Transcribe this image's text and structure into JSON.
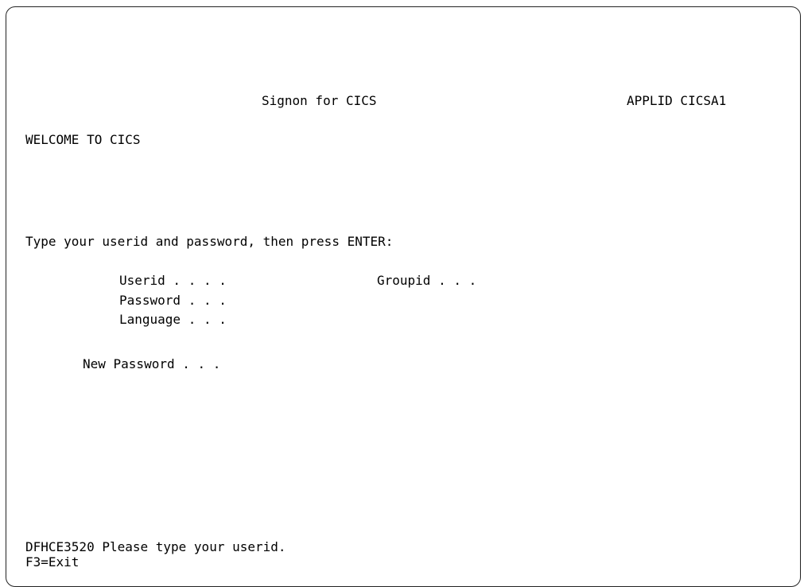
{
  "screen": {
    "title": "Signon for CICS",
    "applid": "APPLID CICSA1",
    "welcome": "WELCOME TO CICS",
    "instruction": "Type your userid and password, then press ENTER:",
    "fields": {
      "userid_label": "Userid . . . .",
      "userid_value": "",
      "groupid_label": "Groupid . . .",
      "groupid_value": "",
      "password_label": "Password . . .",
      "password_value": "",
      "language_label": "Language . . .",
      "language_value": "",
      "new_password_label": "New Password . . .",
      "new_password_value": ""
    },
    "message": "DFHCE3520 Please type your userid.",
    "function_keys": "F3=Exit"
  }
}
